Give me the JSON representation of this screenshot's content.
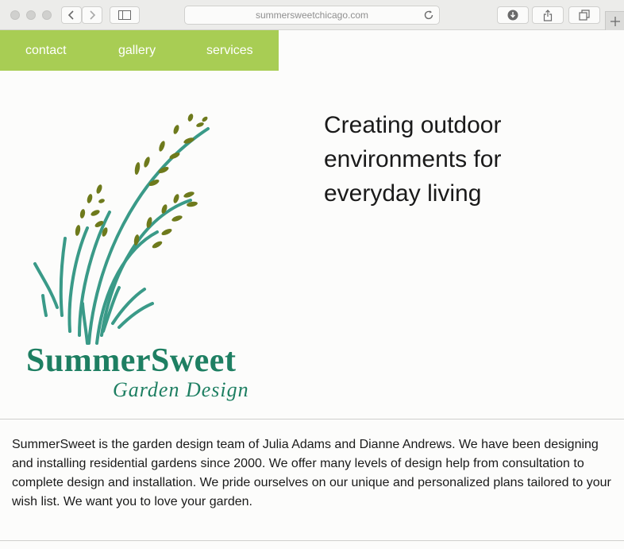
{
  "browser": {
    "url": "summersweetchicago.com",
    "icons": {
      "back": "chevron-left-icon",
      "forward": "chevron-right-icon",
      "sidebar": "sidebar-icon",
      "reload": "reload-icon",
      "download": "download-icon",
      "share": "share-icon",
      "tabs": "tabs-icon",
      "new_tab": "plus-icon"
    }
  },
  "nav": {
    "items": [
      {
        "label": "contact"
      },
      {
        "label": "gallery"
      },
      {
        "label": "services"
      }
    ],
    "bg_color": "#a8cd54"
  },
  "logo": {
    "name": "SummerSweet",
    "subtitle": "Garden Design",
    "brand_color": "#1e7f62",
    "seed_color": "#6e7a1c",
    "stem_color": "#3a9a88"
  },
  "hero": {
    "tagline_line1": "Creating outdoor",
    "tagline_line2": "environments for",
    "tagline_line3": "everyday living"
  },
  "about": {
    "text": "SummerSweet is the garden design team of Julia Adams and Dianne Andrews. We have been designing and installing residential gardens since 2000. We offer many levels of design help from consultation to complete design and installation. We pride ourselves on our unique and personalized plans tailored to your wish list. We want you to love your garden."
  }
}
